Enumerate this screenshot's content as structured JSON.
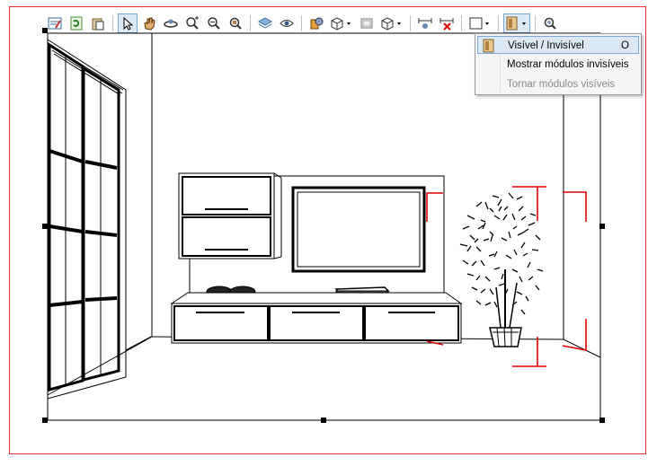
{
  "toolbar": {
    "buttons": [
      {
        "name": "edit-properties",
        "icon": "edit-icon"
      },
      {
        "name": "refresh",
        "icon": "refresh-icon"
      },
      {
        "name": "clipboard",
        "icon": "clipboard-icon"
      },
      {
        "name": "select",
        "icon": "cursor-arrow-icon",
        "active": true
      },
      {
        "name": "pan",
        "icon": "hand-icon"
      },
      {
        "name": "orbit",
        "icon": "orbit-icon"
      },
      {
        "name": "zoom-in",
        "icon": "zoom-in-icon"
      },
      {
        "name": "zoom-out",
        "icon": "zoom-out-icon"
      },
      {
        "name": "zoom-extents",
        "icon": "zoom-extents-icon"
      },
      {
        "name": "layers",
        "icon": "layers-icon"
      },
      {
        "name": "visibility",
        "icon": "eye-icon"
      },
      {
        "name": "render-mode",
        "icon": "render-icon"
      },
      {
        "name": "view-mode",
        "icon": "view-cube-dropdown-icon"
      },
      {
        "name": "frame",
        "icon": "frame-icon"
      },
      {
        "name": "3d-box",
        "icon": "box-dropdown-icon"
      },
      {
        "name": "dimensions",
        "icon": "dimension-icon"
      },
      {
        "name": "delete-dimensions",
        "icon": "dimension-delete-icon"
      },
      {
        "name": "rectangle",
        "icon": "rectangle-dropdown-icon"
      },
      {
        "name": "module-visibility",
        "icon": "module-dropdown-icon",
        "active": true
      },
      {
        "name": "inspect",
        "icon": "inspect-icon"
      }
    ]
  },
  "menu": {
    "items": [
      {
        "label": "Visível / Invisível",
        "shortcut": "O",
        "highlighted": true,
        "enabled": true
      },
      {
        "label": "Mostrar módulos invisíveis",
        "shortcut": "",
        "highlighted": false,
        "enabled": true
      },
      {
        "label": "Tornar módulos visíveis",
        "shortcut": "",
        "highlighted": false,
        "enabled": false
      }
    ]
  },
  "colors": {
    "frame_border": "#e03030",
    "selection_marker": "#e00000",
    "menu_highlight": "#dde8f5"
  }
}
